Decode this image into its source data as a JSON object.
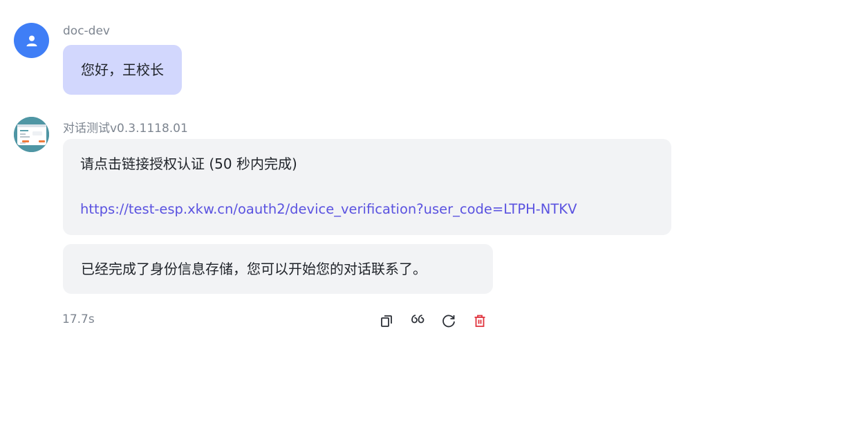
{
  "user_message": {
    "sender": "doc-dev",
    "avatar_icon": "user-icon",
    "text": "您好，王校长"
  },
  "bot_message": {
    "sender": "对话测试v0.3.1118.01",
    "auth_prompt": "请点击链接授权认证 (50 秒内完成)",
    "auth_link": "https://test-esp.xkw.cn/oauth2/device_verification?user_code=LTPH-NTKV",
    "followup_text": "已经完成了身份信息存储，您可以开始您的对话联系了。",
    "elapsed": "17.7s"
  },
  "actions": [
    {
      "name": "copy",
      "icon": "copy-icon"
    },
    {
      "name": "quote",
      "icon": "quote-icon"
    },
    {
      "name": "regenerate",
      "icon": "refresh-icon"
    },
    {
      "name": "delete",
      "icon": "trash-icon"
    }
  ],
  "colors": {
    "user_avatar": "#3f7ef6",
    "user_bubble": "#d2d7fd",
    "bot_bubble": "#f2f3f5",
    "link": "#5a52e0",
    "delete": "#e0323c"
  }
}
